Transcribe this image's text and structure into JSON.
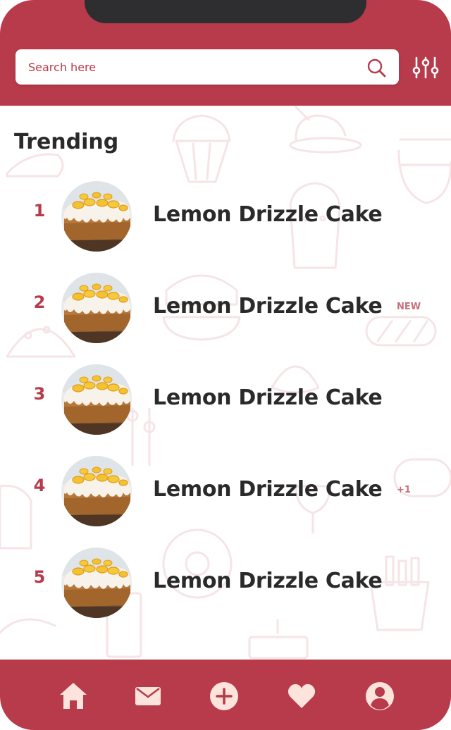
{
  "search": {
    "placeholder": "Search here",
    "value": ""
  },
  "icons": {
    "search": "search-icon",
    "filter": "sliders-icon",
    "nav": [
      "home-icon",
      "mail-icon",
      "add-circle-icon",
      "heart-icon",
      "profile-icon"
    ]
  },
  "colors": {
    "brand": "#b73b4a",
    "notch": "#2e2e30",
    "text": "#2a2a2a",
    "badge": "#c4707a",
    "nav_icon": "#fce3dc"
  },
  "trending": {
    "title": "Trending",
    "items": [
      {
        "rank": "1",
        "name": "Lemon Drizzle Cake",
        "badge": ""
      },
      {
        "rank": "2",
        "name": "Lemon Drizzle Cake",
        "badge": "NEW"
      },
      {
        "rank": "3",
        "name": "Lemon Drizzle Cake",
        "badge": ""
      },
      {
        "rank": "4",
        "name": "Lemon Drizzle Cake",
        "badge": "+1"
      },
      {
        "rank": "5",
        "name": "Lemon Drizzle Cake",
        "badge": ""
      }
    ]
  }
}
